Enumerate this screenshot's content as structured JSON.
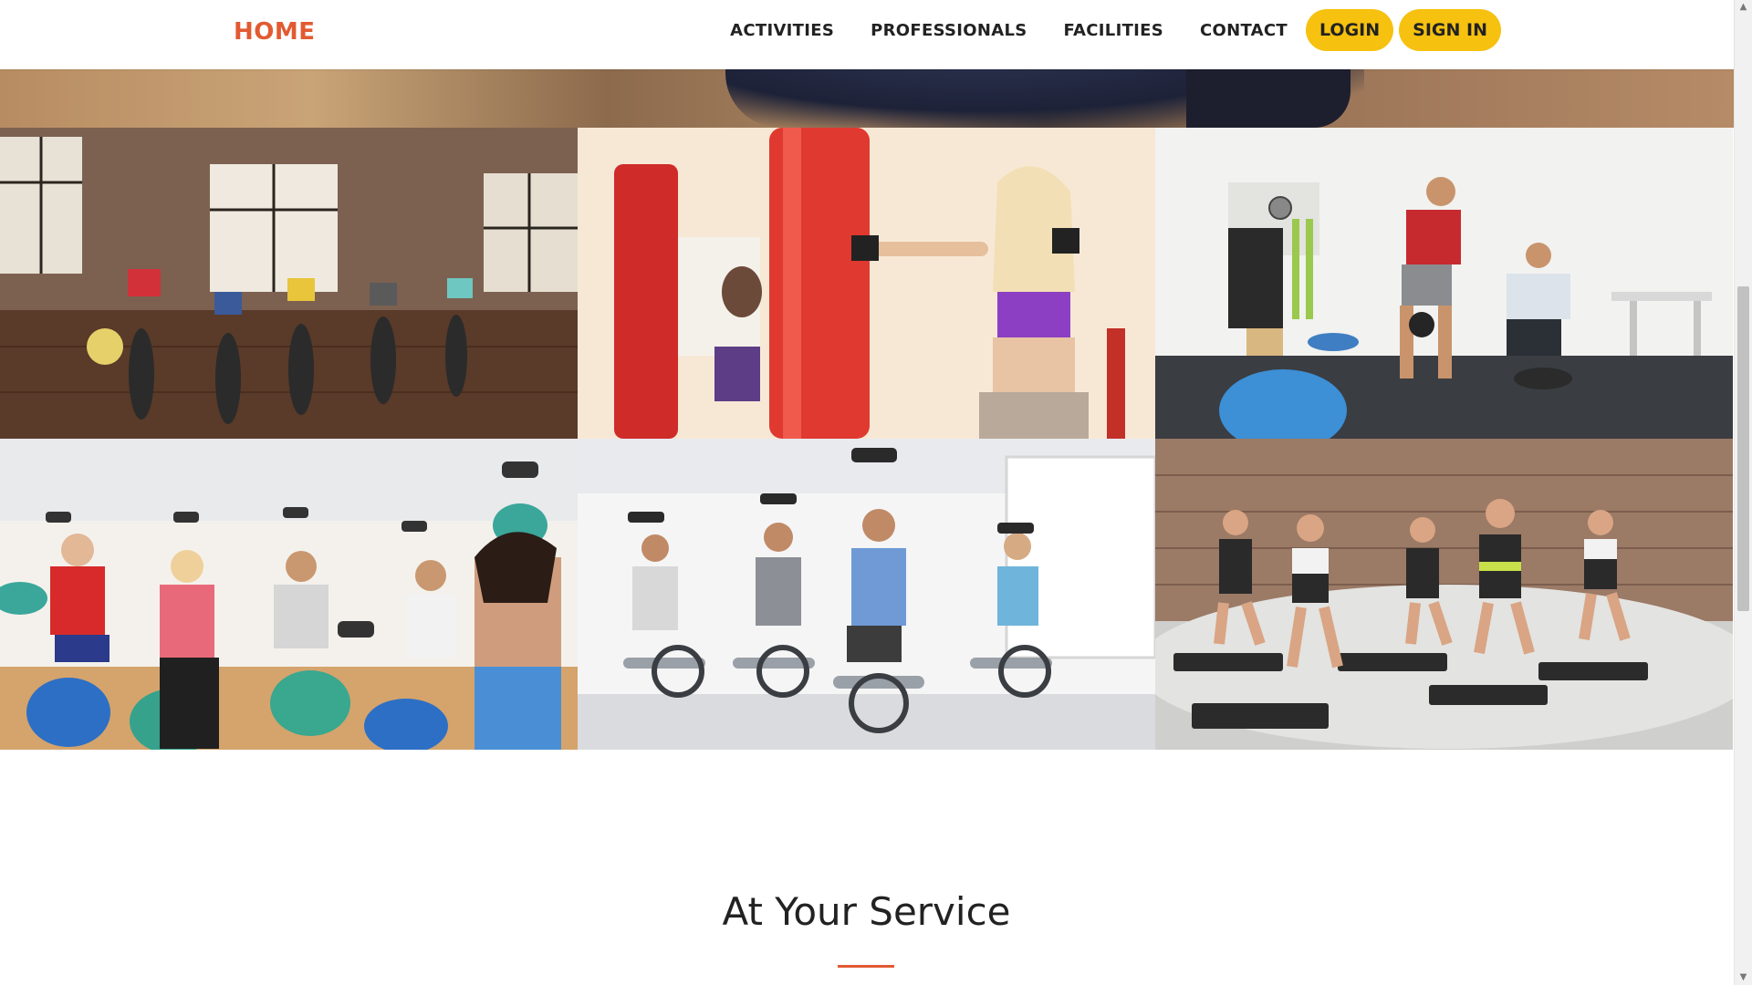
{
  "nav": {
    "brand": "HOME",
    "links": [
      "ACTIVITIES",
      "PROFESSIONALS",
      "FACILITIES",
      "CONTACT"
    ],
    "login_label": "LOGIN",
    "signin_label": "SIGN IN"
  },
  "gallery": {
    "tiles": [
      "group-stretching-class",
      "boxing-punching-bag",
      "personal-trainer-kettlebell",
      "dumbbell-class-on-fitness-balls",
      "indoor-cycling-class",
      "step-aerobics-class"
    ]
  },
  "section": {
    "title": "At Your Service"
  },
  "colors": {
    "accent": "#e25a32",
    "button": "#f6c10f",
    "text": "#222222"
  }
}
